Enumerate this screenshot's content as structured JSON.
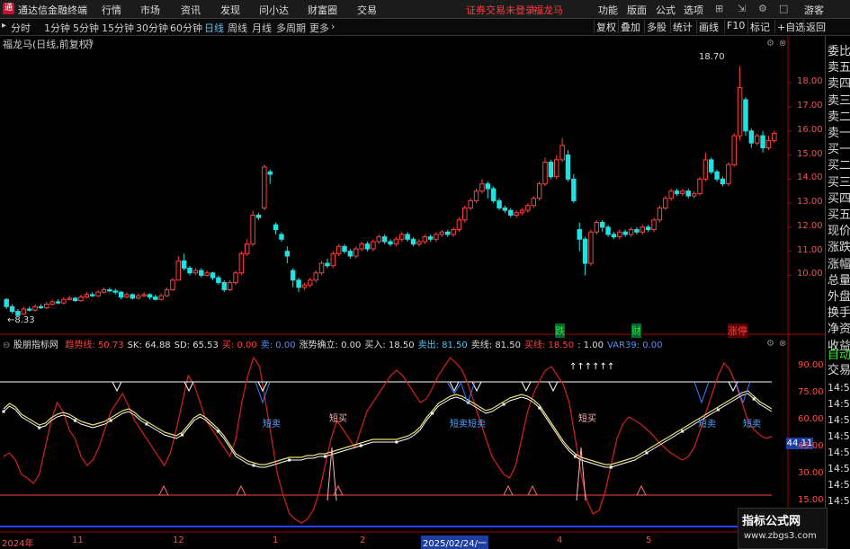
{
  "titlebar": {
    "app_title": "通达信金融终端",
    "menu": [
      "行情",
      "市场",
      "资讯",
      "发现",
      "问小达",
      "财富圈",
      "交易"
    ],
    "warning": "证券交易未登录",
    "stock_name": "福龙马",
    "controls": [
      "功能",
      "版面",
      "公式",
      "选项"
    ],
    "guest": "游客"
  },
  "periodbar": {
    "items": [
      "分时",
      "1分钟",
      "5分钟",
      "15分钟",
      "30分钟",
      "60分钟",
      "日线",
      "周线",
      "月线",
      "多周期",
      "更多"
    ],
    "active": "日线",
    "right_buttons": [
      "复权",
      "叠加",
      "多股",
      "统计",
      "画线",
      "F10",
      "标记",
      "+自选",
      "返回"
    ]
  },
  "chart_header": "福龙马(日线,前复权)",
  "sidebar": {
    "items": [
      "委比",
      "卖五",
      "卖四",
      "卖三",
      "卖二",
      "卖一",
      "买一",
      "买二",
      "买三",
      "买四",
      "买五",
      "现价",
      "涨跌",
      "涨幅",
      "总量",
      "外盘",
      "换手",
      "净资",
      "收益"
    ],
    "auto_trade": [
      "自动",
      "交易"
    ],
    "times": [
      "14:56",
      "14:56",
      "14:56",
      "14:56",
      "14:56",
      "14:56",
      "14:56",
      "14:56"
    ]
  },
  "indicator": {
    "name": "股朋指标网",
    "legend": [
      {
        "label": "趋势线:",
        "value": "50.73",
        "color": "#ff4040"
      },
      {
        "label": "SK:",
        "value": "64.88",
        "color": "#dddddd"
      },
      {
        "label": "SD:",
        "value": "65.53",
        "color": "#dddddd"
      },
      {
        "label": "买:",
        "value": "0.00",
        "color": "#ff4040"
      },
      {
        "label": "卖:",
        "value": "0.00",
        "color": "#4f8fff"
      },
      {
        "label": "涨势确立:",
        "value": "0.00",
        "color": "#dddddd"
      },
      {
        "label": "买入:",
        "value": "18.50",
        "color": "#dddddd"
      },
      {
        "label": "卖出:",
        "value": "81.50",
        "color": "#4fc3f7"
      },
      {
        "label": "卖线:",
        "value": "81.50",
        "color": "#dddddd"
      },
      {
        "label": "买线:",
        "value": "18.50",
        "color": "#ff4040"
      },
      {
        "label": ":",
        "value": "1.00",
        "color": "#dddddd"
      },
      {
        "label": "VAR39:",
        "value": "0.00",
        "color": "#4f8fff"
      }
    ],
    "current_value_tag": "44.11",
    "annotations": {
      "short_sell": "短卖",
      "short_buy": "短买",
      "arrows": "↑↑↑↑↑↑"
    }
  },
  "price_labels": {
    "high": "18.70",
    "low": "8.33"
  },
  "signal_labels": [
    "跌",
    "财",
    "涨停"
  ],
  "x_axis": [
    "2024年",
    "11",
    "12",
    "1",
    "2",
    "2025/02/24/一",
    "4",
    "5"
  ],
  "watermark": {
    "title": "指标公式网",
    "url": "www.zbgs3.com"
  },
  "colors": {
    "up": "#ff4040",
    "down": "#20e0e0",
    "accent": "#4fc3f7"
  },
  "chart_data": {
    "type": "candlestick",
    "y_ticks": [
      10.0,
      11.0,
      12.0,
      13.0,
      14.0,
      15.0,
      16.0,
      17.0,
      18.0
    ],
    "ylim": [
      8.0,
      19.5
    ],
    "indicator_y_ticks": [
      15.0,
      30.0,
      45.0,
      60.0,
      75.0,
      90.0
    ],
    "indicator_ylim": [
      0,
      100
    ],
    "buy_line": 18.5,
    "sell_line": 81.5,
    "candles": [
      [
        9.0,
        8.7,
        9.05,
        8.6
      ],
      [
        8.7,
        8.5,
        8.8,
        8.4
      ],
      [
        8.5,
        8.33,
        8.6,
        8.33
      ],
      [
        8.4,
        8.6,
        8.7,
        8.35
      ],
      [
        8.6,
        8.55,
        8.7,
        8.5
      ],
      [
        8.55,
        8.7,
        8.8,
        8.5
      ],
      [
        8.7,
        8.65,
        8.8,
        8.6
      ],
      [
        8.65,
        8.8,
        8.9,
        8.6
      ],
      [
        8.8,
        8.9,
        9.0,
        8.75
      ],
      [
        8.9,
        8.85,
        9.0,
        8.8
      ],
      [
        8.85,
        9.0,
        9.1,
        8.8
      ],
      [
        9.0,
        9.05,
        9.15,
        8.95
      ],
      [
        9.05,
        8.95,
        9.1,
        8.9
      ],
      [
        8.95,
        9.1,
        9.2,
        8.9
      ],
      [
        9.1,
        9.2,
        9.3,
        9.05
      ],
      [
        9.2,
        9.15,
        9.3,
        9.1
      ],
      [
        9.15,
        9.3,
        9.4,
        9.1
      ],
      [
        9.3,
        9.4,
        9.5,
        9.25
      ],
      [
        9.4,
        9.35,
        9.5,
        9.3
      ],
      [
        9.35,
        9.3,
        9.45,
        9.2
      ],
      [
        9.3,
        9.1,
        9.35,
        9.0
      ],
      [
        9.1,
        9.2,
        9.3,
        9.05
      ],
      [
        9.2,
        9.05,
        9.25,
        9.0
      ],
      [
        9.05,
        9.15,
        9.25,
        9.0
      ],
      [
        9.15,
        9.2,
        9.3,
        9.1
      ],
      [
        9.2,
        9.1,
        9.25,
        9.0
      ],
      [
        9.1,
        9.0,
        9.2,
        8.95
      ],
      [
        9.0,
        9.15,
        9.25,
        8.95
      ],
      [
        9.15,
        9.4,
        9.5,
        9.1
      ],
      [
        9.4,
        9.8,
        9.9,
        9.35
      ],
      [
        9.8,
        10.6,
        10.8,
        9.8
      ],
      [
        10.6,
        10.3,
        10.9,
        10.2
      ],
      [
        10.3,
        10.1,
        10.4,
        10.0
      ],
      [
        10.1,
        10.2,
        10.3,
        10.0
      ],
      [
        10.2,
        10.0,
        10.3,
        9.9
      ],
      [
        10.0,
        10.1,
        10.2,
        9.95
      ],
      [
        10.1,
        9.9,
        10.15,
        9.8
      ],
      [
        9.9,
        9.7,
        10.0,
        9.6
      ],
      [
        9.7,
        9.4,
        9.8,
        9.3
      ],
      [
        9.4,
        9.7,
        9.8,
        9.35
      ],
      [
        9.7,
        10.1,
        10.2,
        9.6
      ],
      [
        10.1,
        10.9,
        11.0,
        10.0
      ],
      [
        10.9,
        11.3,
        11.5,
        10.8
      ],
      [
        11.3,
        12.5,
        12.7,
        11.2
      ],
      [
        12.5,
        12.4,
        12.6,
        12.3
      ],
      [
        12.8,
        14.5,
        14.6,
        12.7
      ],
      [
        14.3,
        14.2,
        14.4,
        13.8
      ],
      [
        12.1,
        11.9,
        12.2,
        11.7
      ],
      [
        11.7,
        11.5,
        11.8,
        11.4
      ],
      [
        11.0,
        10.8,
        11.2,
        10.5
      ],
      [
        10.2,
        9.8,
        10.3,
        9.5
      ],
      [
        9.8,
        9.5,
        9.9,
        9.3
      ],
      [
        9.5,
        9.6,
        9.7,
        9.4
      ],
      [
        9.6,
        9.8,
        9.9,
        9.5
      ],
      [
        9.8,
        10.1,
        10.2,
        9.7
      ],
      [
        10.1,
        10.5,
        10.6,
        10.0
      ],
      [
        10.5,
        10.4,
        10.7,
        10.3
      ],
      [
        10.4,
        10.9,
        11.0,
        10.3
      ],
      [
        10.9,
        11.2,
        11.3,
        10.8
      ],
      [
        11.2,
        11.0,
        11.3,
        10.9
      ],
      [
        11.0,
        10.8,
        11.1,
        10.7
      ],
      [
        10.8,
        11.1,
        11.2,
        10.7
      ],
      [
        11.1,
        11.3,
        11.4,
        11.0
      ],
      [
        11.3,
        11.1,
        11.4,
        11.0
      ],
      [
        11.1,
        11.4,
        11.5,
        11.0
      ],
      [
        11.4,
        11.6,
        11.7,
        11.3
      ],
      [
        11.6,
        11.4,
        11.7,
        11.3
      ],
      [
        11.4,
        11.3,
        11.5,
        11.2
      ],
      [
        11.3,
        11.5,
        11.6,
        11.2
      ],
      [
        11.5,
        11.7,
        11.8,
        11.4
      ],
      [
        11.7,
        11.5,
        11.8,
        11.4
      ],
      [
        11.5,
        11.3,
        11.6,
        11.2
      ],
      [
        11.3,
        11.4,
        11.5,
        11.2
      ],
      [
        11.4,
        11.6,
        11.7,
        11.3
      ],
      [
        11.6,
        11.5,
        11.7,
        11.4
      ],
      [
        11.5,
        11.7,
        11.8,
        11.4
      ],
      [
        11.7,
        11.8,
        11.9,
        11.6
      ],
      [
        11.8,
        11.7,
        11.9,
        11.6
      ],
      [
        11.7,
        11.9,
        12.0,
        11.6
      ],
      [
        11.9,
        12.3,
        12.4,
        11.8
      ],
      [
        12.3,
        12.8,
        12.9,
        12.2
      ],
      [
        12.8,
        13.1,
        13.2,
        12.7
      ],
      [
        13.1,
        13.5,
        13.6,
        13.0
      ],
      [
        13.5,
        13.8,
        14.0,
        13.4
      ],
      [
        13.8,
        13.6,
        13.9,
        13.2
      ],
      [
        13.6,
        13.1,
        13.7,
        13.0
      ],
      [
        13.1,
        12.8,
        13.2,
        12.7
      ],
      [
        12.8,
        12.7,
        12.9,
        12.6
      ],
      [
        12.7,
        12.5,
        12.8,
        12.4
      ],
      [
        12.5,
        12.6,
        12.7,
        12.4
      ],
      [
        12.6,
        12.7,
        12.8,
        12.5
      ],
      [
        12.7,
        12.9,
        13.0,
        12.6
      ],
      [
        12.9,
        13.2,
        13.3,
        12.8
      ],
      [
        13.2,
        13.8,
        13.9,
        13.1
      ],
      [
        13.8,
        14.7,
        14.9,
        13.7
      ],
      [
        14.7,
        14.1,
        14.8,
        14.0
      ],
      [
        14.1,
        14.8,
        15.0,
        14.0
      ],
      [
        14.8,
        15.4,
        15.7,
        14.7
      ],
      [
        15.0,
        14.0,
        15.2,
        13.9
      ],
      [
        14.0,
        13.1,
        14.2,
        13.0
      ],
      [
        11.9,
        11.5,
        12.2,
        11.0
      ],
      [
        11.5,
        10.5,
        11.6,
        10.0
      ],
      [
        10.5,
        11.8,
        11.9,
        10.4
      ],
      [
        11.8,
        12.2,
        12.3,
        11.7
      ],
      [
        12.2,
        12.0,
        12.3,
        11.8
      ],
      [
        12.0,
        11.7,
        12.1,
        11.6
      ],
      [
        11.7,
        11.6,
        11.8,
        11.5
      ],
      [
        11.6,
        11.8,
        11.9,
        11.5
      ],
      [
        11.8,
        11.7,
        11.9,
        11.6
      ],
      [
        11.7,
        11.9,
        12.0,
        11.6
      ],
      [
        11.9,
        11.8,
        12.0,
        11.7
      ],
      [
        11.8,
        12.0,
        12.1,
        11.7
      ],
      [
        12.0,
        11.9,
        12.1,
        11.8
      ],
      [
        11.9,
        12.3,
        12.4,
        11.8
      ],
      [
        12.3,
        12.8,
        12.9,
        12.2
      ],
      [
        12.8,
        13.2,
        13.3,
        12.7
      ],
      [
        13.2,
        13.5,
        13.6,
        13.1
      ],
      [
        13.5,
        13.4,
        13.6,
        13.3
      ],
      [
        13.4,
        13.5,
        13.6,
        13.3
      ],
      [
        13.5,
        13.3,
        13.6,
        13.2
      ],
      [
        13.3,
        13.4,
        13.5,
        13.2
      ],
      [
        13.4,
        14.0,
        14.1,
        13.3
      ],
      [
        14.0,
        14.8,
        15.1,
        13.9
      ],
      [
        14.8,
        14.3,
        14.9,
        14.2
      ],
      [
        14.3,
        14.0,
        14.4,
        13.9
      ],
      [
        14.0,
        13.8,
        14.1,
        13.7
      ],
      [
        13.8,
        14.6,
        14.7,
        13.7
      ],
      [
        14.6,
        15.8,
        15.9,
        14.5
      ],
      [
        15.8,
        17.8,
        18.7,
        15.6
      ],
      [
        17.3,
        16.0,
        17.4,
        15.8
      ],
      [
        16.0,
        15.5,
        16.1,
        15.3
      ],
      [
        15.5,
        15.8,
        15.9,
        15.4
      ],
      [
        15.8,
        15.3,
        16.0,
        15.1
      ],
      [
        15.3,
        15.6,
        15.8,
        15.2
      ],
      [
        15.6,
        15.9,
        16.0,
        15.5
      ]
    ],
    "trend_line": [
      40,
      42,
      38,
      30,
      28,
      25,
      30,
      45,
      60,
      70,
      65,
      55,
      50,
      40,
      35,
      38,
      45,
      55,
      65,
      70,
      75,
      68,
      60,
      55,
      50,
      45,
      40,
      35,
      42,
      55,
      70,
      85,
      80,
      70,
      60,
      55,
      50,
      45,
      40,
      50,
      70,
      85,
      95,
      90,
      70,
      50,
      30,
      18,
      8,
      5,
      3,
      5,
      10,
      20,
      35,
      50,
      60,
      55,
      50,
      45,
      55,
      65,
      70,
      75,
      80,
      85,
      88,
      85,
      80,
      75,
      70,
      72,
      78,
      85,
      90,
      95,
      92,
      88,
      80,
      70,
      60,
      50,
      40,
      35,
      30,
      28,
      35,
      50,
      65,
      75,
      82,
      88,
      90,
      85,
      80,
      70,
      50,
      30,
      15,
      8,
      10,
      20,
      35,
      50,
      58,
      62,
      60,
      58,
      55,
      52,
      48,
      45,
      42,
      40,
      38,
      40,
      45,
      55,
      65,
      75,
      85,
      92,
      88,
      80,
      70,
      60,
      55,
      52,
      50,
      51
    ],
    "sk_line": [
      65,
      68,
      66,
      62,
      60,
      58,
      56,
      57,
      60,
      62,
      63,
      62,
      60,
      58,
      57,
      56,
      57,
      58,
      60,
      62,
      64,
      65,
      63,
      60,
      58,
      56,
      54,
      52,
      51,
      50,
      52,
      56,
      60,
      62,
      60,
      57,
      54,
      50,
      45,
      40,
      38,
      36,
      35,
      34,
      34,
      35,
      36,
      37,
      38,
      38,
      38,
      39,
      39,
      40,
      40,
      41,
      42,
      43,
      44,
      45,
      46,
      47,
      48,
      48,
      48,
      48,
      48,
      49,
      50,
      52,
      55,
      60,
      64,
      68,
      70,
      72,
      73,
      72,
      70,
      68,
      66,
      64,
      65,
      67,
      69,
      71,
      72,
      73,
      72,
      70,
      67,
      62,
      57,
      52,
      47,
      43,
      40,
      38,
      37,
      36,
      35,
      34,
      34,
      35,
      36,
      37,
      38,
      40,
      42,
      44,
      46,
      48,
      50,
      52,
      54,
      56,
      58,
      60,
      62,
      64,
      66,
      68,
      70,
      72,
      74,
      75,
      72,
      69,
      67,
      65
    ]
  }
}
